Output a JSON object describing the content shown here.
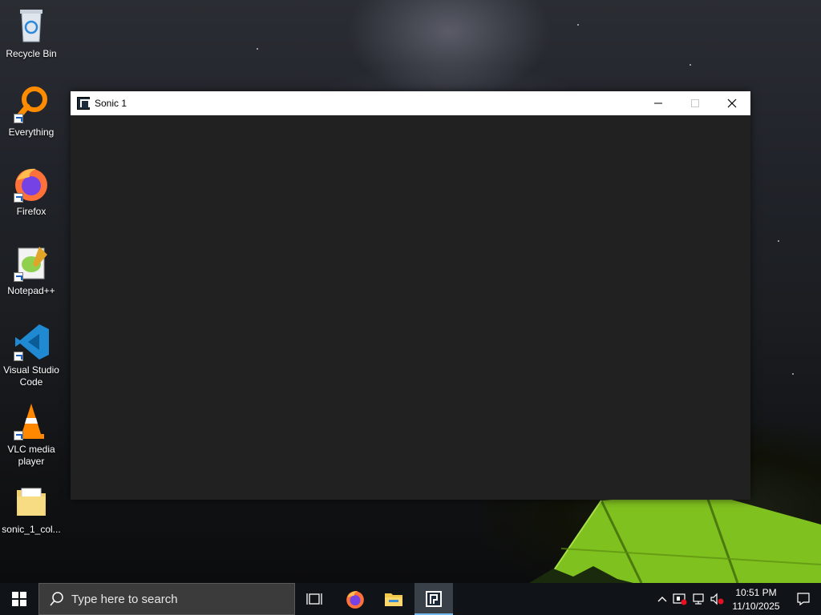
{
  "desktop": {
    "icons": [
      {
        "label": "Recycle Bin",
        "icon": "recycle-bin-icon"
      },
      {
        "label": "Everything",
        "icon": "everything-search-icon"
      },
      {
        "label": "Firefox",
        "icon": "firefox-icon"
      },
      {
        "label": "Notepad++",
        "icon": "notepad-plus-plus-icon"
      },
      {
        "label": "Visual Studio Code",
        "icon": "vscode-icon"
      },
      {
        "label": "VLC media player",
        "icon": "vlc-icon"
      },
      {
        "label": "sonic_1_col...",
        "icon": "folder-icon"
      }
    ]
  },
  "window": {
    "title": "Sonic 1",
    "client_color": "#212121",
    "controls": {
      "minimize": "minimize-icon",
      "maximize": "maximize-icon",
      "close": "close-icon"
    }
  },
  "taskbar": {
    "search_placeholder": "Type here to search",
    "pinned": [
      "task-view-icon",
      "firefox-icon",
      "file-explorer-icon",
      "sonic-app-icon"
    ],
    "active_item": "sonic-app-icon",
    "tray": {
      "icons": [
        "chevron-up-icon",
        "security-warning-icon",
        "network-icon",
        "volume-muted-icon"
      ],
      "time": "10:51 PM",
      "date": "11/10/2025"
    },
    "accent": "#76b9ed"
  }
}
